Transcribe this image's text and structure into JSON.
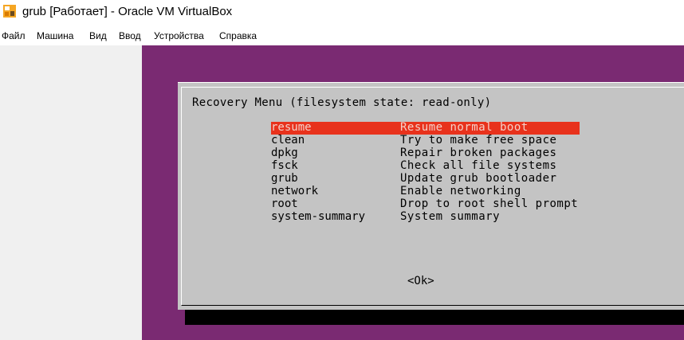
{
  "window": {
    "title": "grub [Работает] - Oracle VM VirtualBox",
    "icon": "virtualbox-app-icon"
  },
  "menubar": {
    "items": [
      "Файл",
      "Машина",
      "Вид",
      "Ввод",
      "Устройства",
      "Справка"
    ]
  },
  "recovery_menu": {
    "title": "Recovery Menu (filesystem state: read-only)",
    "selected_index": 0,
    "items": [
      {
        "key": "resume",
        "description": "Resume normal boot"
      },
      {
        "key": "clean",
        "description": "Try to make free space"
      },
      {
        "key": "dpkg",
        "description": "Repair broken packages"
      },
      {
        "key": "fsck",
        "description": "Check all file systems"
      },
      {
        "key": "grub",
        "description": "Update grub bootloader"
      },
      {
        "key": "network",
        "description": "Enable networking"
      },
      {
        "key": "root",
        "description": "Drop to root shell prompt"
      },
      {
        "key": "system-summary",
        "description": "System summary"
      }
    ],
    "ok_button": "<Ok>"
  },
  "colors": {
    "vm_background": "#7a2a72",
    "dialog_background": "#c4c4c4",
    "selection": "#e8321c"
  }
}
